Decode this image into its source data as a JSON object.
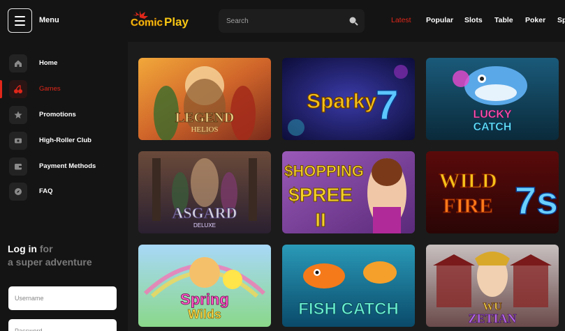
{
  "header": {
    "menu_label": "Menu",
    "logo": {
      "word1": "Comic",
      "word2": "Play"
    },
    "search_placeholder": "Search",
    "tabs": [
      "Latest",
      "Popular",
      "Slots",
      "Table",
      "Poker",
      "Sp"
    ],
    "active_tab": "Latest"
  },
  "sidebar": {
    "items": [
      {
        "label": "Home",
        "icon": "home-icon"
      },
      {
        "label": "Games",
        "icon": "cherries-icon",
        "active": true
      },
      {
        "label": "Promotions",
        "icon": "star-icon"
      },
      {
        "label": "High-Roller Club",
        "icon": "card-icon"
      },
      {
        "label": "Payment Methods",
        "icon": "wallet-icon"
      },
      {
        "label": "FAQ",
        "icon": "compass-icon"
      }
    ],
    "login": {
      "title_strong": "Log in",
      "title_dim": "for",
      "subtitle": "a super adventure",
      "username_placeholder": "Username",
      "password_placeholder": "Password"
    }
  },
  "games": [
    {
      "title_line1": "LEGEND",
      "title_line2": "HELIOS"
    },
    {
      "title_line1": "Sparky",
      "title_line2": "7"
    },
    {
      "title_line1": "LUCKY",
      "title_line2": "CATCH"
    },
    {
      "title_line1": "ASGARD",
      "title_line2": "DELUXE"
    },
    {
      "title_line1": "$HOPPING",
      "title_line2": "$PREE",
      "title_line3": "II"
    },
    {
      "title_line1": "WILD",
      "title_line2": "FIRE",
      "title_line3": "7s"
    },
    {
      "title_line1": "Spring",
      "title_line2": "Wilds"
    },
    {
      "title_line1": "FISH",
      "title_line2": "CATCH"
    },
    {
      "title_line1": "WU",
      "title_line2": "ZETIAN"
    }
  ],
  "colors": {
    "accent": "#e0271a",
    "background": "#141414",
    "content_bg": "#1b1b1b",
    "logo_yellow": "#f7c613"
  }
}
